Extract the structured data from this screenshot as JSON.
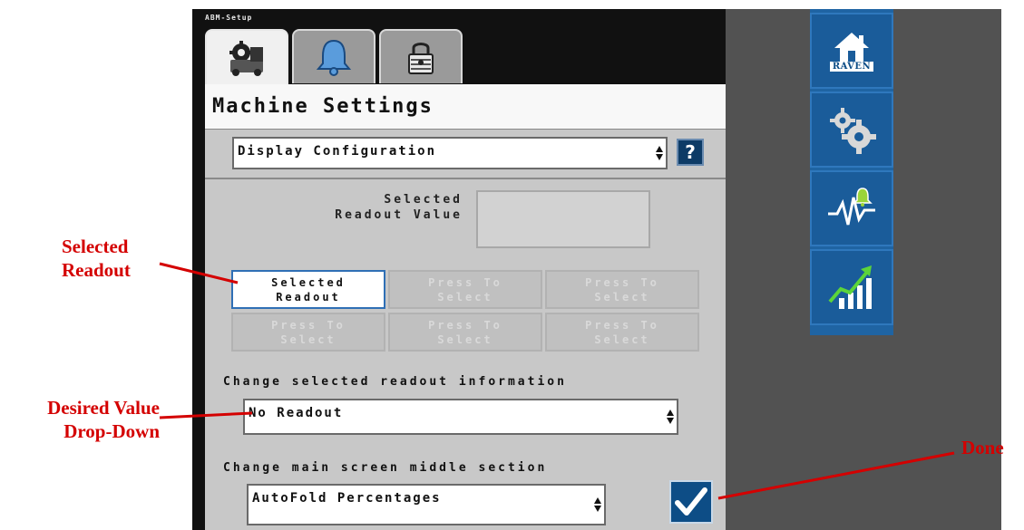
{
  "window": {
    "title": "ABM-Setup"
  },
  "tabs": [
    {
      "name": "machine-setup",
      "icon": "machine-gears-icon",
      "active": true
    },
    {
      "name": "alarms",
      "icon": "bell-icon",
      "active": false
    },
    {
      "name": "locked",
      "icon": "padlock-icon",
      "active": false
    }
  ],
  "page": {
    "title": "Machine Settings"
  },
  "config_dropdown": {
    "value": "Display Configuration"
  },
  "help": {
    "label": "?"
  },
  "readout": {
    "label_line1": "Selected",
    "label_line2": "Readout Value",
    "value": ""
  },
  "readout_buttons": [
    {
      "label": "Selected\nReadout",
      "selected": true
    },
    {
      "label": "Press To\nSelect",
      "selected": false
    },
    {
      "label": "Press To\nSelect",
      "selected": false
    },
    {
      "label": "Press To\nSelect",
      "selected": false
    },
    {
      "label": "Press To\nSelect",
      "selected": false
    },
    {
      "label": "Press To\nSelect",
      "selected": false
    }
  ],
  "readout_info": {
    "label": "Change selected readout information",
    "value": "No Readout"
  },
  "middle_section": {
    "label": "Change main screen middle section",
    "value": "AutoFold Percentages"
  },
  "side_menu": {
    "home": {
      "icon": "home-icon",
      "brand": "RAVEN"
    },
    "settings": {
      "icon": "gears-icon"
    },
    "diagnostics": {
      "icon": "pulse-alarm-icon"
    },
    "performance": {
      "icon": "growth-chart-icon"
    }
  },
  "annotations": {
    "selected_readout": [
      "Selected",
      "Readout"
    ],
    "desired_value": [
      "Desired Value",
      "Drop-Down"
    ],
    "done": "Done"
  },
  "colors": {
    "annotation": "#d40000",
    "button_blue": "#0d4d86",
    "side_panel": "#1f64a3",
    "selection_border": "#2f6fb5"
  }
}
